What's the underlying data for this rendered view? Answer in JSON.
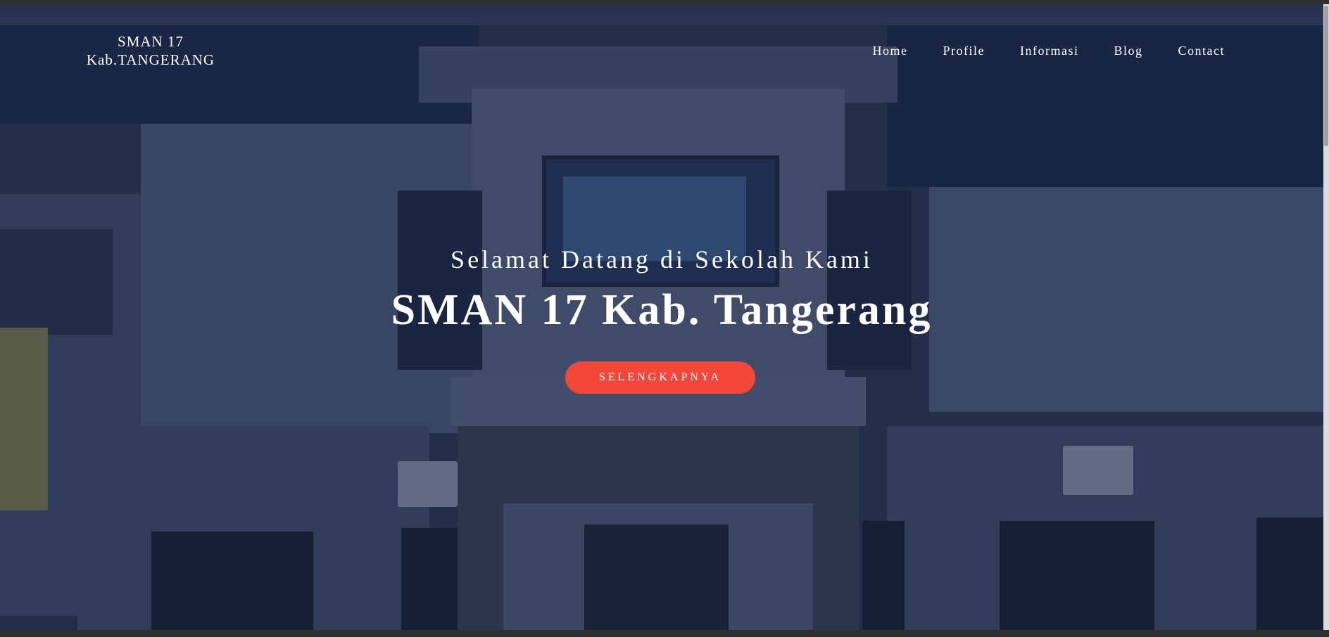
{
  "header": {
    "logo_line1": "SMAN 17",
    "logo_line2": "Kab.TANGERANG",
    "nav": [
      {
        "label": "Home"
      },
      {
        "label": "Profile"
      },
      {
        "label": "Informasi"
      },
      {
        "label": "Blog"
      },
      {
        "label": "Contact"
      }
    ]
  },
  "hero": {
    "subtitle": "Selamat Datang di Sekolah Kami",
    "title": "SMAN 17 Kab. Tangerang",
    "cta_label": "SELENGKAPNYA",
    "cta_color": "#f4473a"
  }
}
